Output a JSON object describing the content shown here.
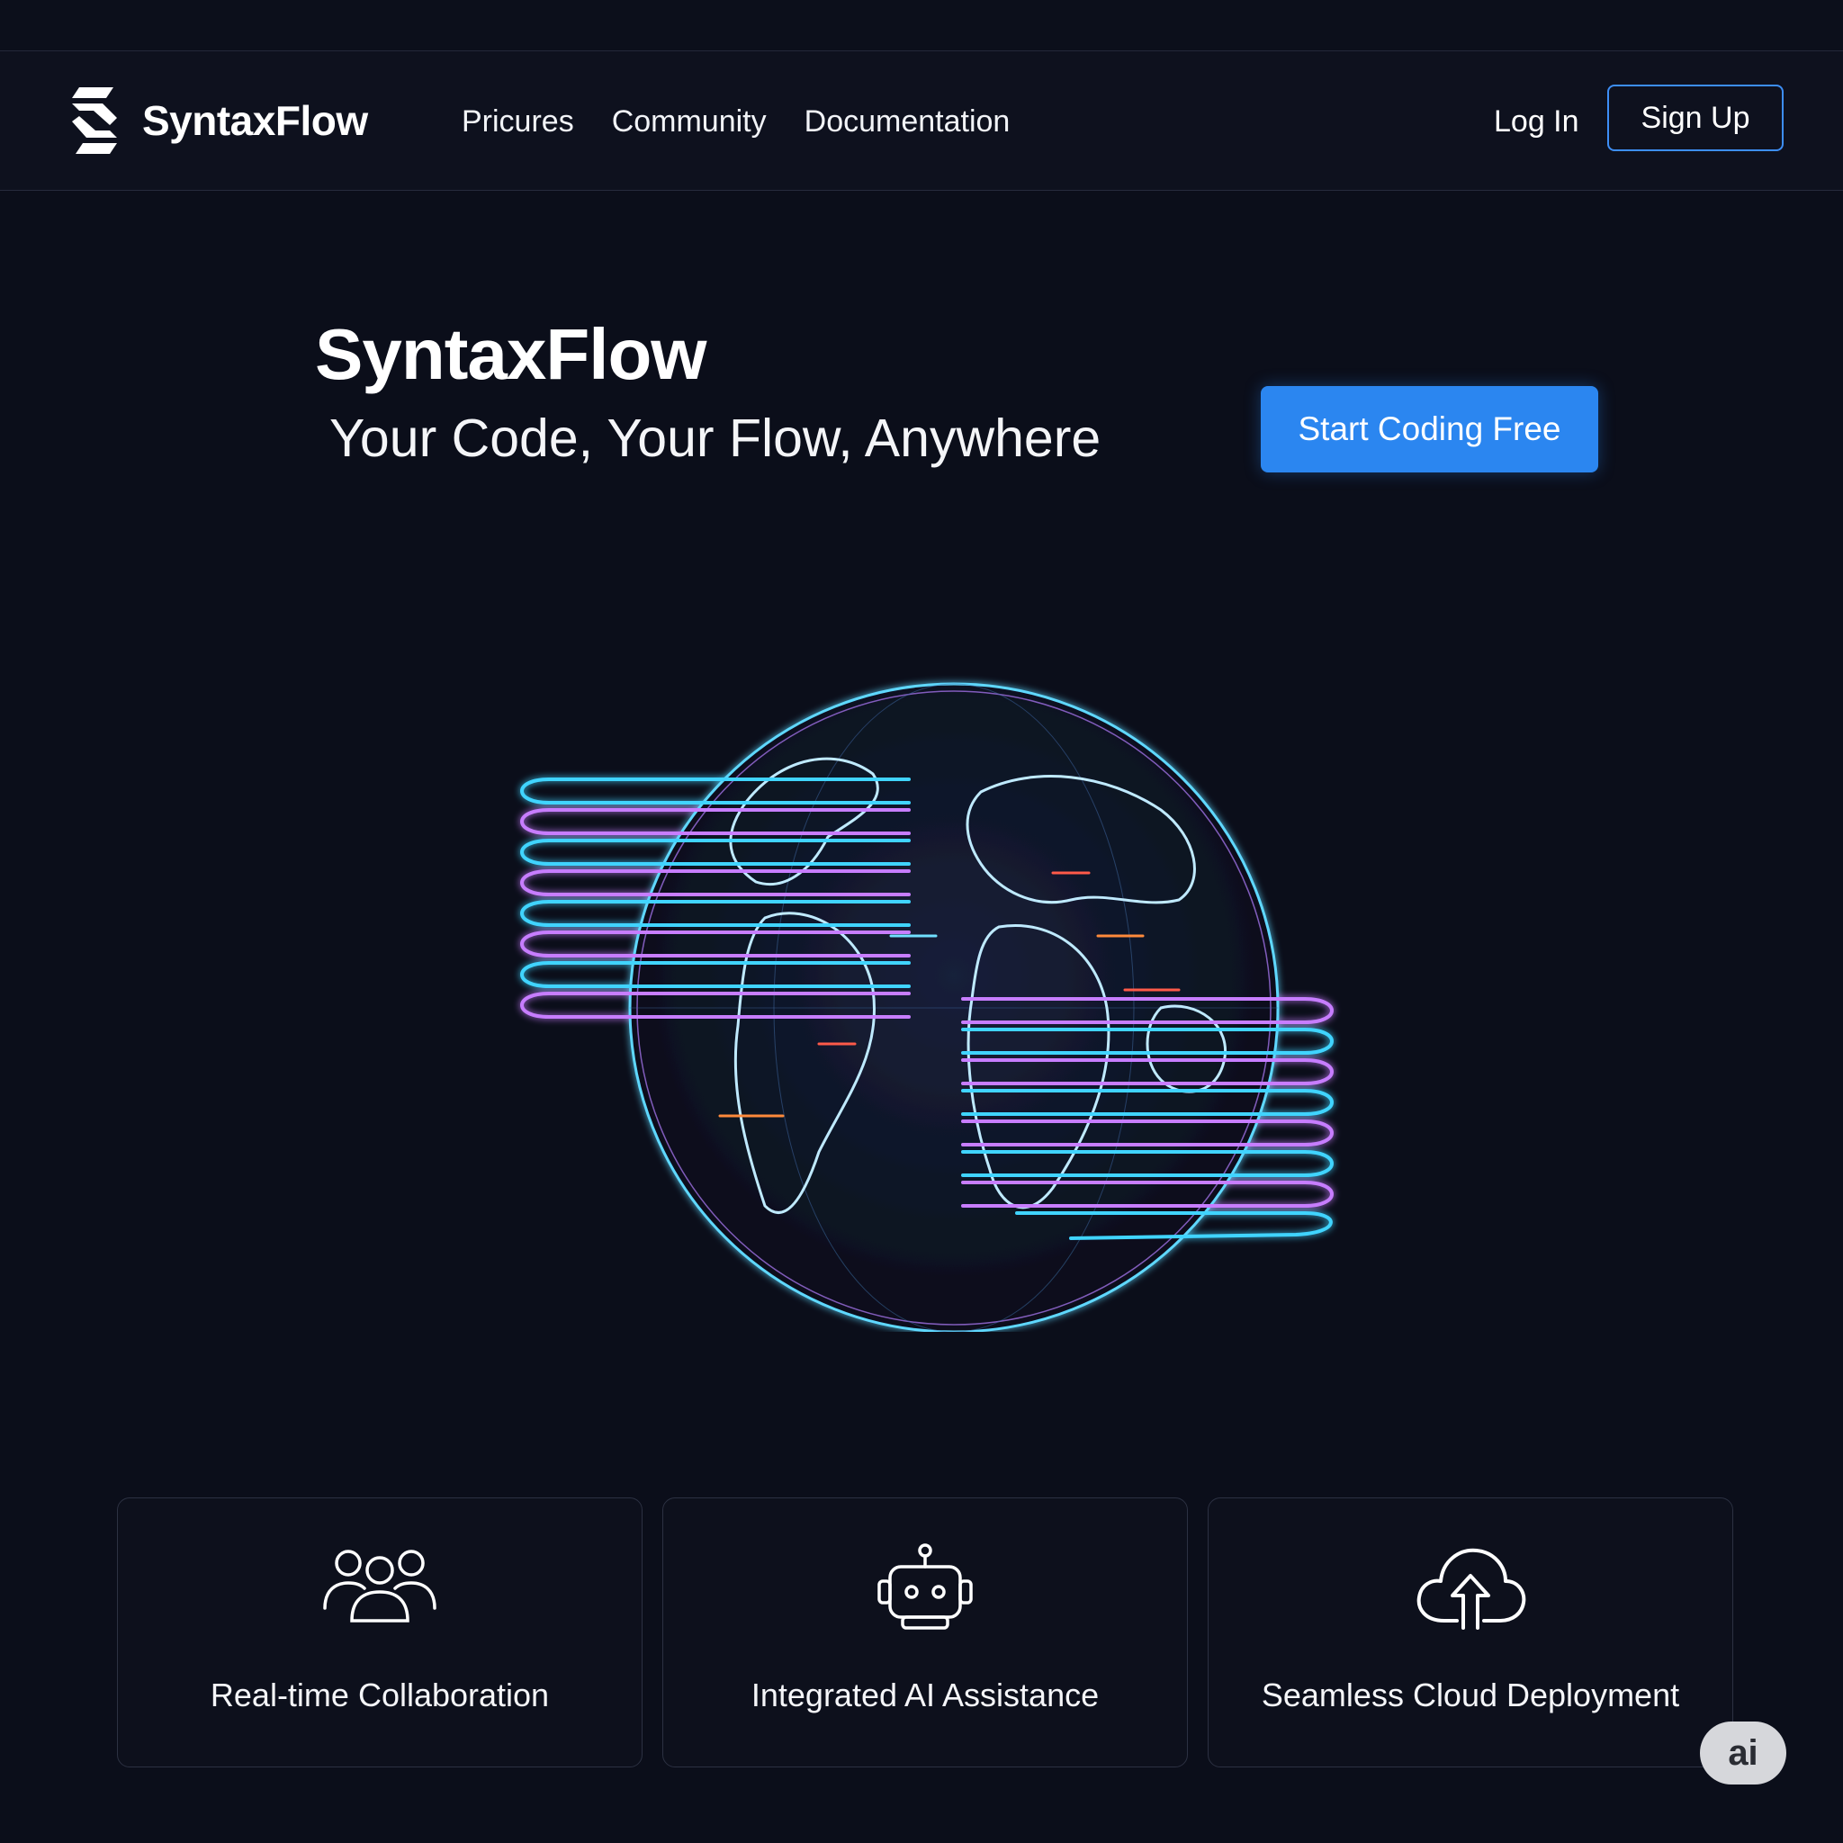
{
  "brand": {
    "name": "SyntaxFlow",
    "logo_icon": "syntaxflow-s-logo-icon"
  },
  "nav": {
    "links": [
      "Pricures",
      "Community",
      "Documentation"
    ],
    "login_label": "Log In",
    "signup_label": "Sign Up"
  },
  "hero": {
    "title": "SyntaxFlow",
    "subtitle": "Your Code, Your Flow, Anywhere",
    "cta_label": "Start Coding Free",
    "illustration": "globe-with-code-streams-icon"
  },
  "features": [
    {
      "label": "Real-time Collaboration",
      "icon": "users-group-icon"
    },
    {
      "label": "Integrated AI Assistance",
      "icon": "robot-icon"
    },
    {
      "label": "Seamless Cloud Deployment",
      "icon": "cloud-upload-icon"
    }
  ],
  "badge": {
    "label": "ai"
  },
  "colors": {
    "background": "#0b0e1a",
    "accent_blue": "#2b86f0",
    "signup_border": "#3d8ef5",
    "glow_cyan": "#3fd4ff",
    "glow_violet": "#c77dff"
  }
}
